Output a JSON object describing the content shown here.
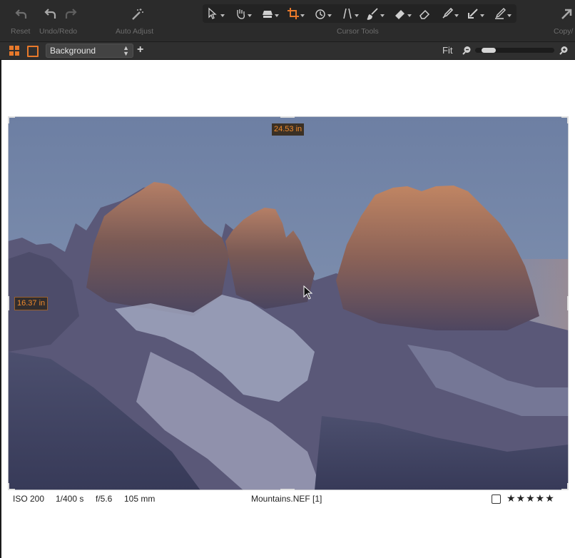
{
  "toolbar": {
    "reset_label": "Reset",
    "undo_redo_label": "Undo/Redo",
    "auto_adjust_label": "Auto Adjust",
    "cursor_tools_label": "Cursor Tools",
    "copy_label": "Copy/",
    "accent_color": "#e8792b",
    "cursor_tools": [
      "select-icon",
      "pan-icon",
      "loupe-icon",
      "crop-icon",
      "rotate-icon",
      "keystone-icon",
      "brush-icon",
      "eraser-icon",
      "erase-icon",
      "picker-icon",
      "arrow-picker-icon",
      "annotate-icon"
    ]
  },
  "subbar": {
    "layer": "Background",
    "zoom_label": "Fit",
    "zoom_level": 0.1
  },
  "viewer": {
    "width_readout": "24.53 in",
    "height_readout": "16.37 in"
  },
  "info": {
    "iso": "ISO 200",
    "shutter": "1/400 s",
    "aperture": "f/5.6",
    "focal": "105 mm",
    "filename": "Mountains.NEF [1]",
    "rating": "★★★★★"
  }
}
